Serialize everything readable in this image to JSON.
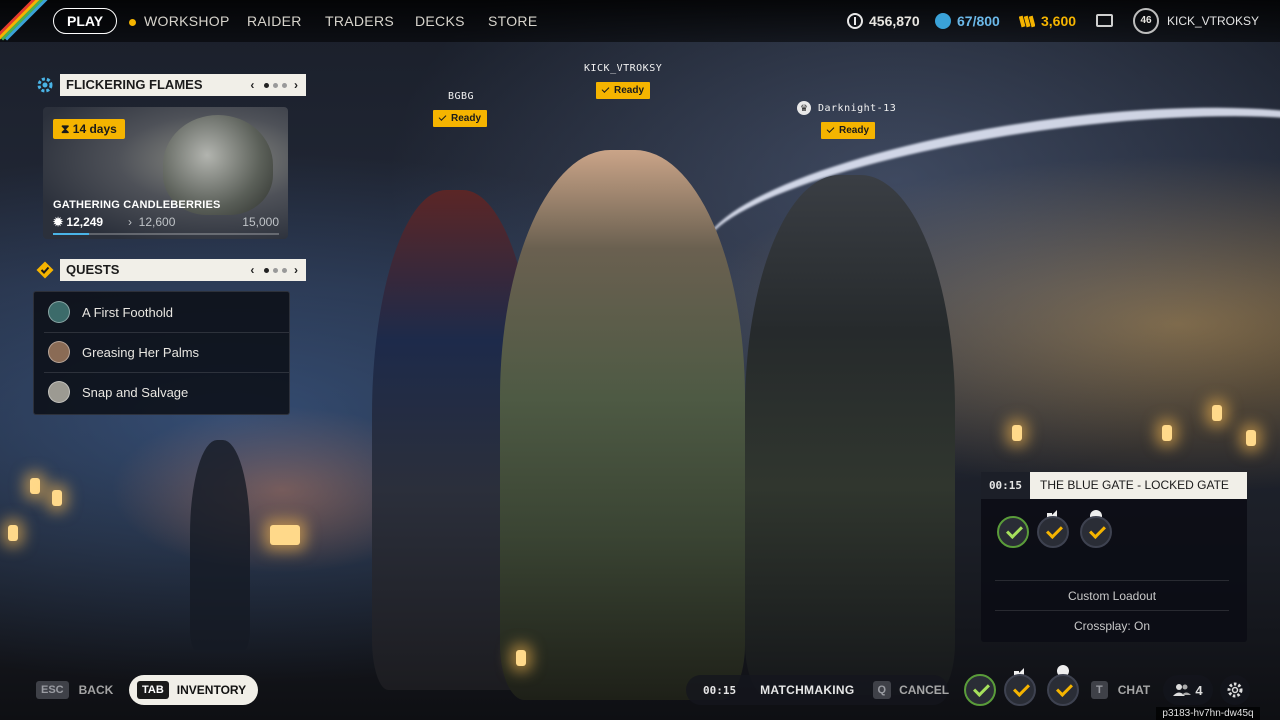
{
  "topbar": {
    "play_label": "PLAY",
    "nav": [
      "WORKSHOP",
      "RAIDER",
      "TRADERS",
      "DECKS",
      "STORE"
    ],
    "currencies": {
      "coins": "456,870",
      "blue": "67/800",
      "gold": "3,600"
    },
    "player_level": "46",
    "username": "KICK_VTROKSY",
    "icons": [
      "coin-icon",
      "blue-token-icon",
      "gold-bars-icon",
      "mail-icon"
    ]
  },
  "event": {
    "title": "FLICKERING FLAMES",
    "timer": "14 days",
    "name": "GATHERING CANDLEBERRIES",
    "progress_current": "12,249",
    "progress_next": "12,600",
    "progress_max": "15,000",
    "progress_fraction": 0.16
  },
  "quests": {
    "title": "QUESTS",
    "items": [
      {
        "label": "A First Foothold",
        "avatar_color": "#3c6b6a"
      },
      {
        "label": "Greasing Her Palms",
        "avatar_color": "#8a6b55"
      },
      {
        "label": "Snap and Salvage",
        "avatar_color": "#9c9a92"
      }
    ]
  },
  "party": {
    "players": [
      {
        "name": "BGBG",
        "status": "Ready"
      },
      {
        "name": "KICK_VTROKSY",
        "status": "Ready"
      },
      {
        "name": "Darknight-13",
        "status": "Ready"
      }
    ]
  },
  "match": {
    "time": "00:15",
    "map": "THE BLUE GATE - LOCKED GATE",
    "loadout": "Custom Loadout",
    "crossplay": "Crossplay: On"
  },
  "bottombar": {
    "back_key": "ESC",
    "back_label": "BACK",
    "inventory_key": "TAB",
    "inventory_label": "INVENTORY",
    "mm_time": "00:15",
    "mm_label": "MATCHMAKING",
    "cancel_key": "Q",
    "cancel_label": "CANCEL",
    "chat_key": "T",
    "chat_label": "CHAT",
    "party_count": "4"
  },
  "session_id": "p3183-hv7hn-dw45q",
  "colors": {
    "accent": "#f5b400",
    "ready_green": "#a6e05c",
    "panel_light": "#f1efe8",
    "progress_blue": "#4ab4e6"
  }
}
